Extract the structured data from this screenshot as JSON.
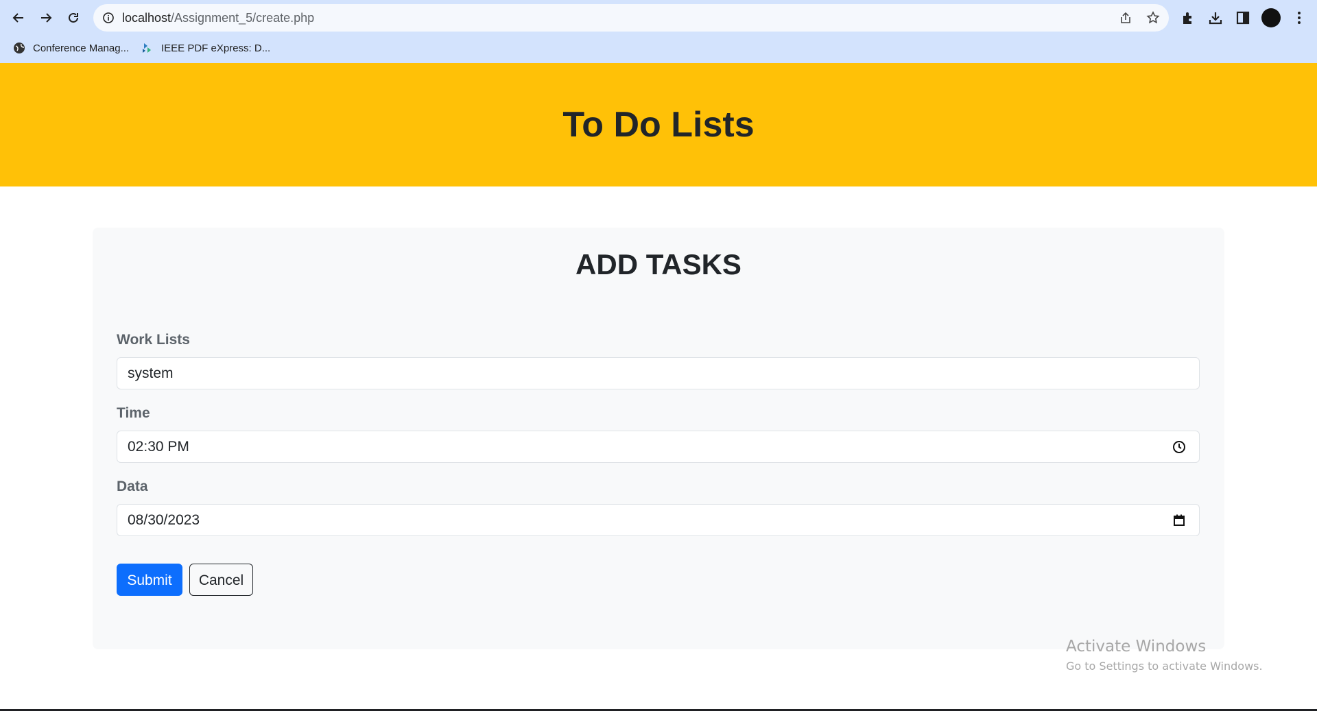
{
  "browser": {
    "url_host": "localhost",
    "url_path": "/Assignment_5/create.php",
    "bookmarks": [
      {
        "label": "Conference Manag..."
      },
      {
        "label": "IEEE PDF eXpress: D..."
      }
    ]
  },
  "header": {
    "title": "To Do Lists",
    "background_color": "#ffc107"
  },
  "form": {
    "title": "ADD TASKS",
    "fields": [
      {
        "label": "Work Lists",
        "value": "system",
        "type": "text"
      },
      {
        "label": "Time",
        "value": "02:30 PM",
        "type": "time"
      },
      {
        "label": "Data",
        "value": "08/30/2023",
        "type": "date"
      }
    ],
    "submit_label": "Submit",
    "cancel_label": "Cancel",
    "submit_color": "#0d6efd"
  },
  "watermark": {
    "title": "Activate Windows",
    "subtitle": "Go to Settings to activate Windows."
  }
}
